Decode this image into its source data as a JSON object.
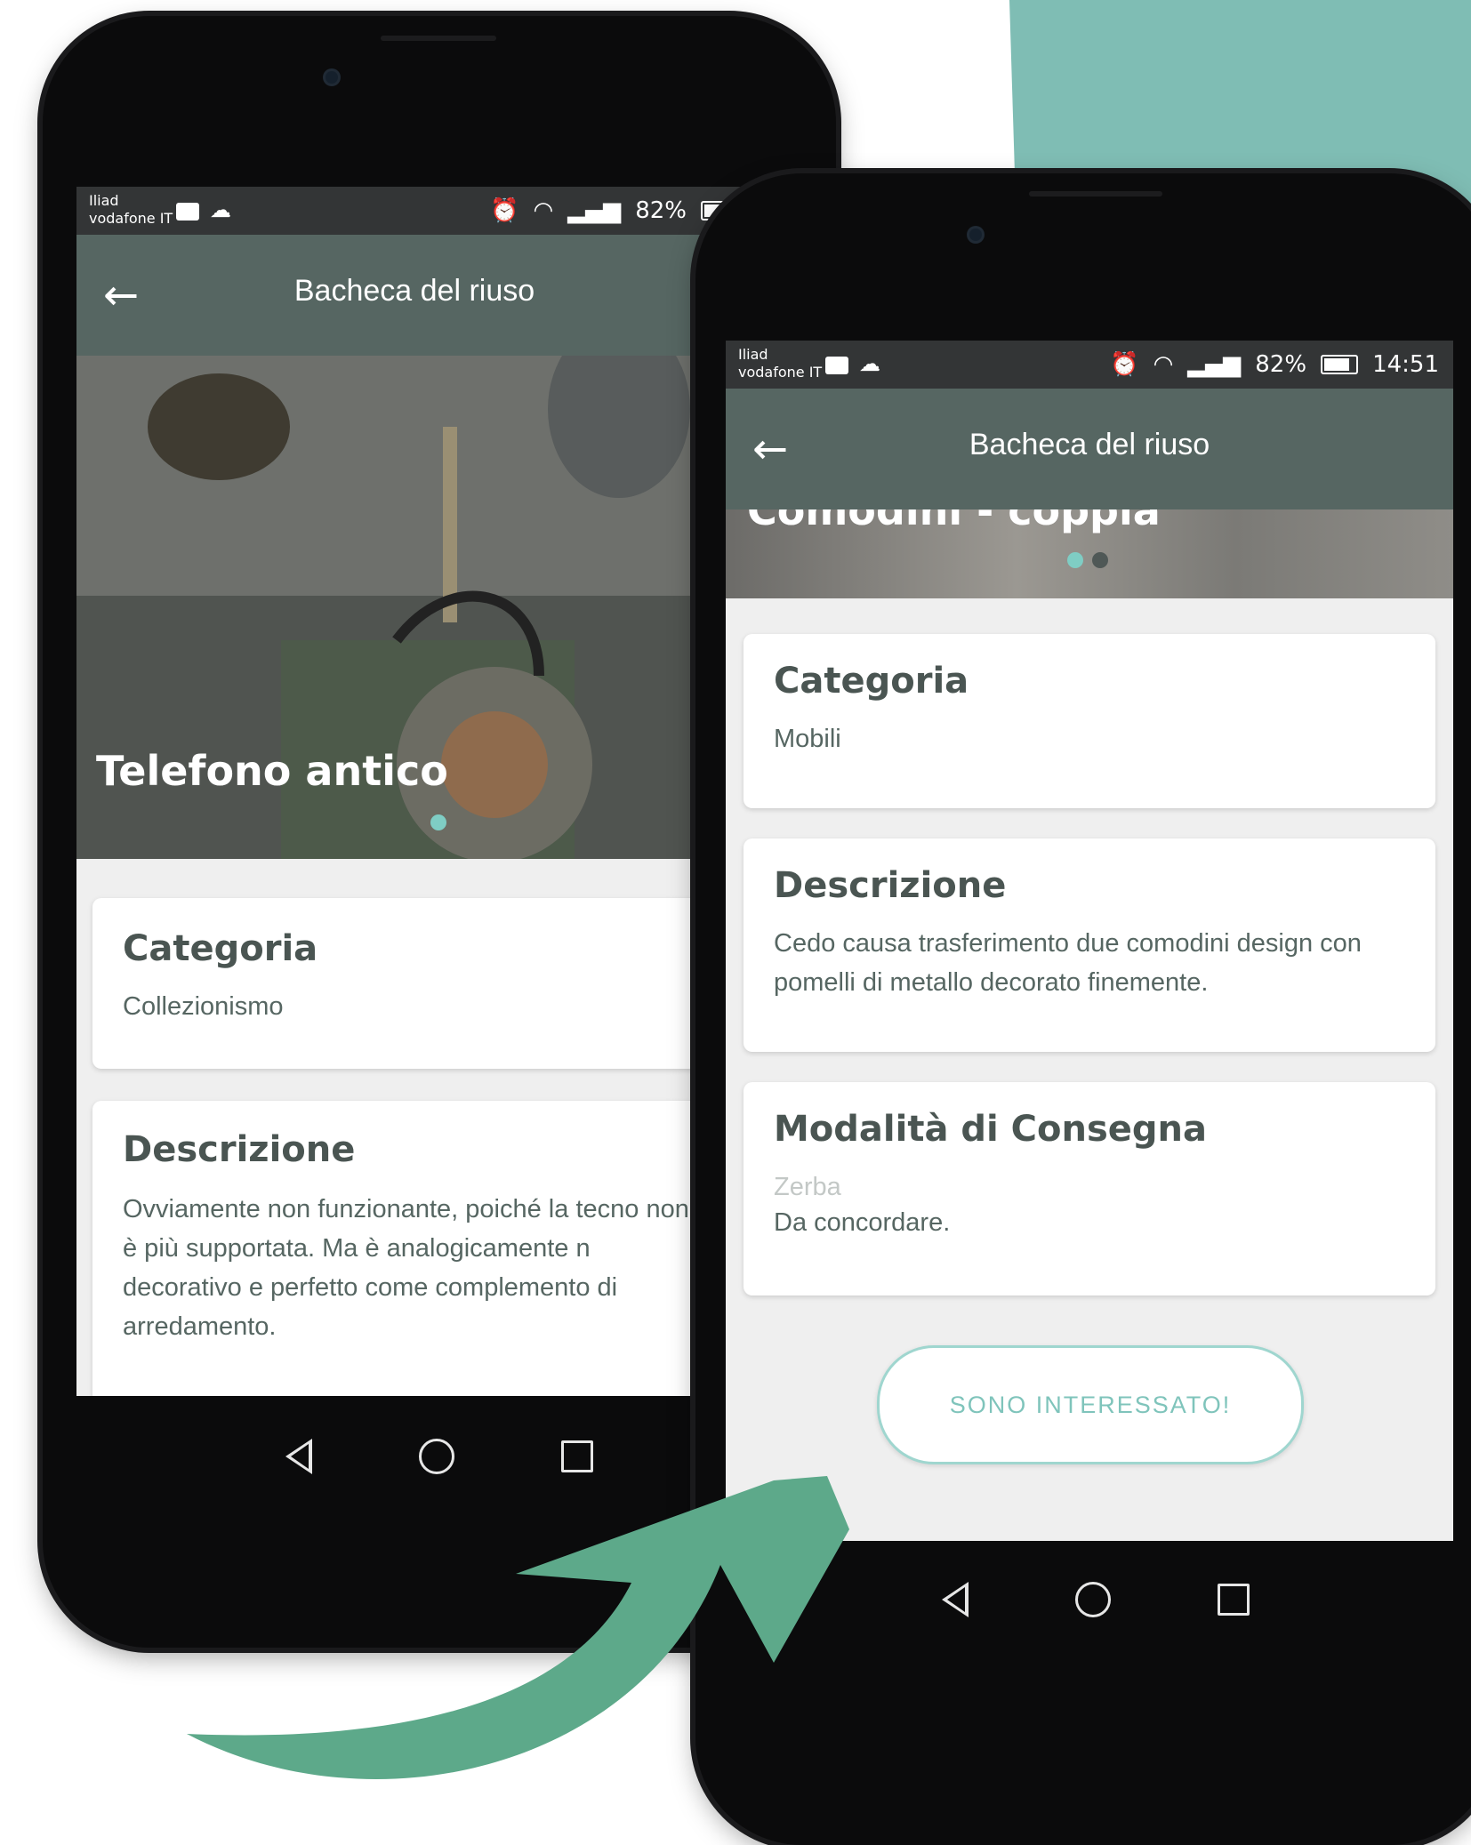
{
  "colors": {
    "accent": "#7fbdb4",
    "appbar": "#566662",
    "arrow": "#5da98a",
    "heading": "#4a5552"
  },
  "phone_left": {
    "status": {
      "carrier_line1": "Iliad",
      "carrier_line2": "vodafone IT",
      "battery_text": "82%"
    },
    "appbar": {
      "back_icon": "←",
      "title": "Bacheca del riuso"
    },
    "hero": {
      "title": "Telefono antico",
      "dots": 1
    },
    "cards": [
      {
        "heading": "Categoria",
        "text": "Collezionismo"
      },
      {
        "heading": "Descrizione",
        "text": "Ovviamente non funzionante, poiché la tecno non è più supportata. Ma è analogicamente n decorativo e perfetto come complemento di arredamento."
      }
    ]
  },
  "phone_right": {
    "status": {
      "carrier_line1": "Iliad",
      "carrier_line2": "vodafone IT",
      "battery_text": "82%",
      "time": "14:51"
    },
    "appbar": {
      "back_icon": "←",
      "title": "Bacheca del riuso"
    },
    "hero": {
      "title": "Comodini - coppia",
      "dots": 2
    },
    "cards": [
      {
        "heading": "Categoria",
        "text": "Mobili"
      },
      {
        "heading": "Descrizione",
        "text": "Cedo causa trasferimento due comodini design con pomelli di metallo decorato finemente."
      },
      {
        "heading": "Modalità di Consegna",
        "subtext": "Zerba",
        "text": "Da concordare."
      }
    ],
    "cta_label": "SONO INTERESSATO!"
  }
}
